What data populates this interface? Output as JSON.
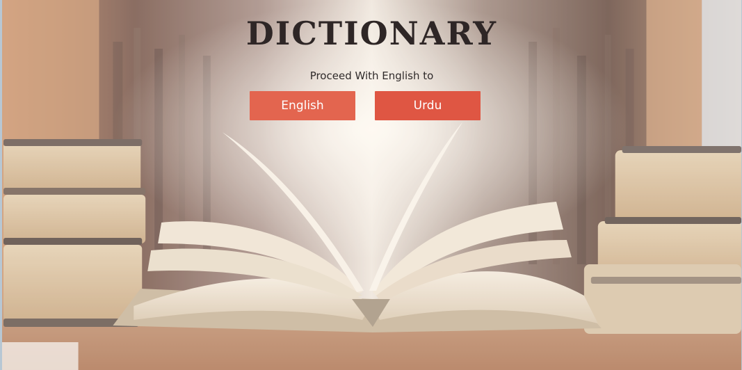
{
  "app": {
    "title": "DICTIONARY",
    "subtitle": "Proceed With English to"
  },
  "buttons": {
    "english_label": "English",
    "urdu_label": "Urdu"
  },
  "colors": {
    "button_english": "#e3654f",
    "button_urdu": "#df5643",
    "title_text": "#2e2626"
  },
  "background": {
    "image_semantic": "library-open-book-photo"
  }
}
